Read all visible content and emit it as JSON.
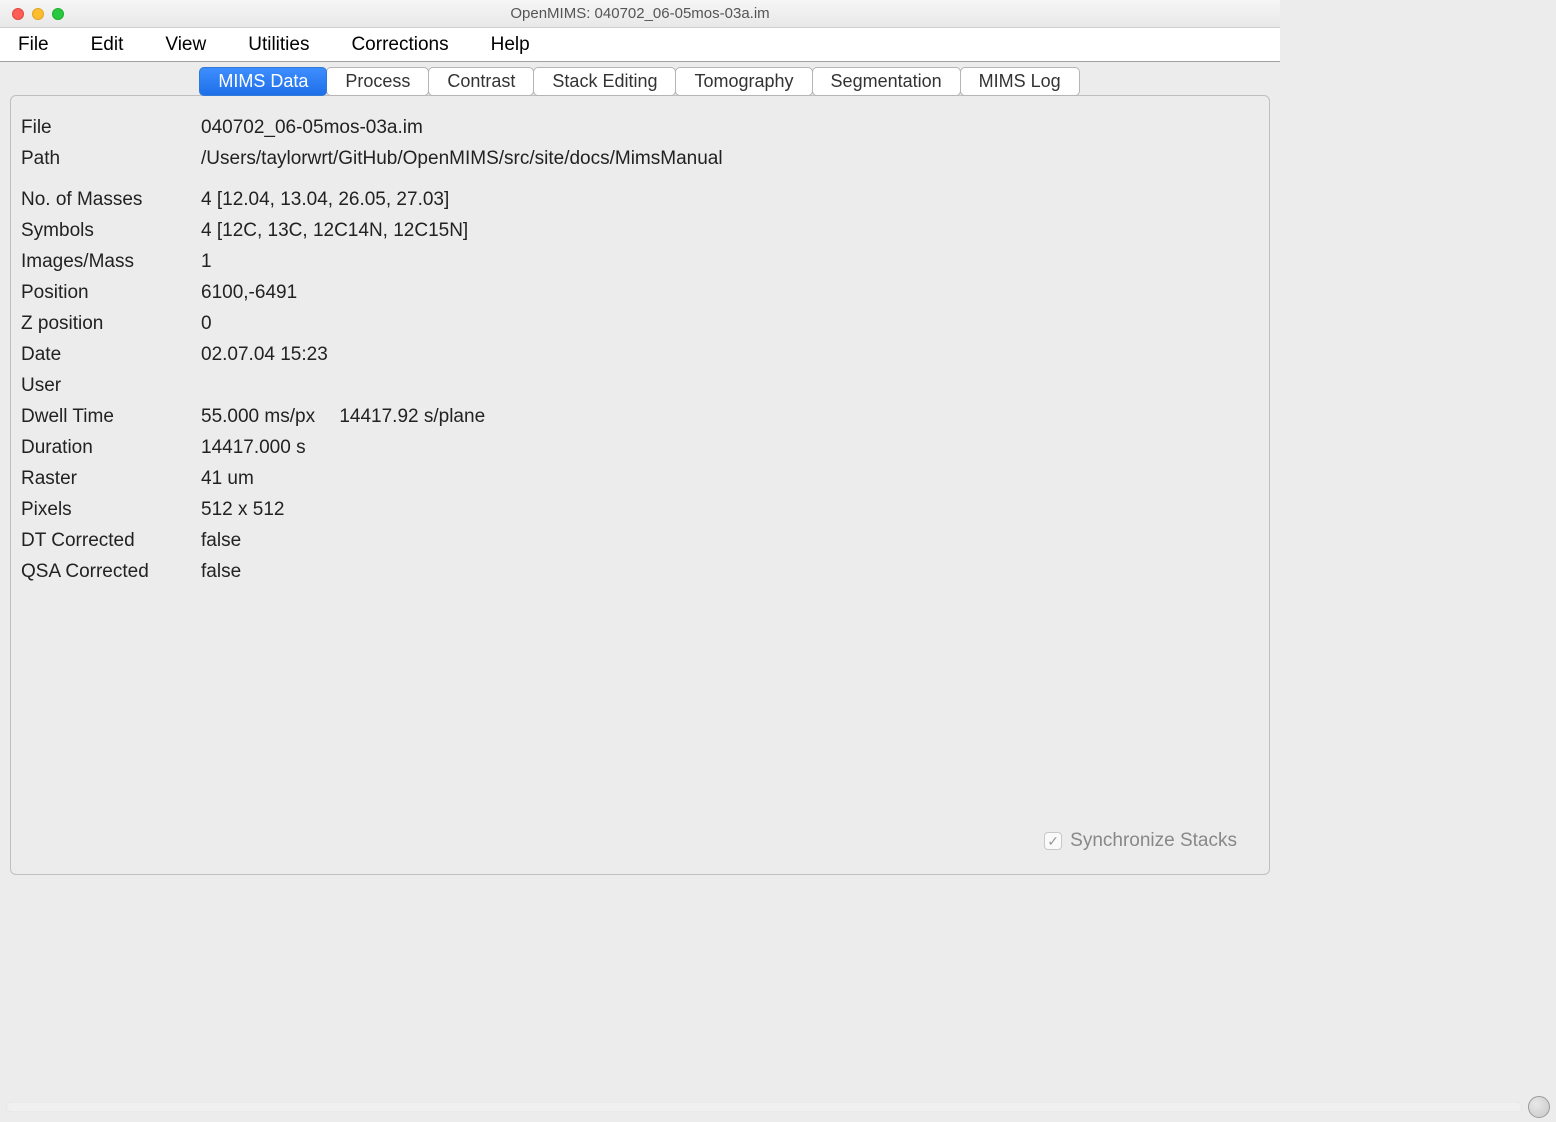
{
  "window": {
    "title": "OpenMIMS: 040702_06-05mos-03a.im"
  },
  "menu": {
    "items": [
      "File",
      "Edit",
      "View",
      "Utilities",
      "Corrections",
      "Help"
    ]
  },
  "tabs": {
    "items": [
      "MIMS Data",
      "Process",
      "Contrast",
      "Stack Editing",
      "Tomography",
      "Segmentation",
      "MIMS Log"
    ],
    "active_index": 0
  },
  "info": {
    "file_label": "File",
    "file_value": "040702_06-05mos-03a.im",
    "path_label": "Path",
    "path_value": "/Users/taylorwrt/GitHub/OpenMIMS/src/site/docs/MimsManual",
    "masses_label": "No. of Masses",
    "masses_value": "4 [12.04, 13.04, 26.05, 27.03]",
    "symbols_label": "Symbols",
    "symbols_value": "4 [12C, 13C, 12C14N, 12C15N]",
    "images_label": "Images/Mass",
    "images_value": "1",
    "position_label": "Position",
    "position_value": "6100,-6491",
    "zpos_label": "Z position",
    "zpos_value": "0",
    "date_label": "Date",
    "date_value": "02.07.04 15:23",
    "user_label": "User",
    "user_value": "",
    "dwell_label": "Dwell Time",
    "dwell_value": "55.000 ms/px  14417.92 s/plane",
    "duration_label": "Duration",
    "duration_value": "14417.000 s",
    "raster_label": "Raster",
    "raster_value": "41 um",
    "pixels_label": "Pixels",
    "pixels_value": "512 x 512",
    "dt_label": "DT Corrected",
    "dt_value": "false",
    "qsa_label": "QSA Corrected",
    "qsa_value": "false"
  },
  "sync": {
    "label": "Synchronize Stacks",
    "checked": true
  }
}
